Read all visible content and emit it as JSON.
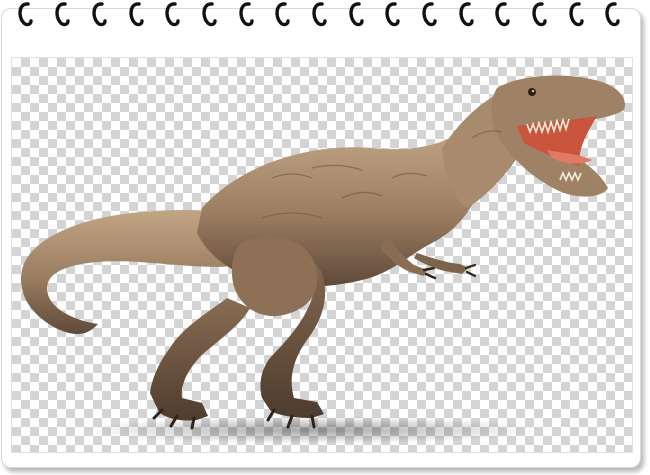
{
  "image": {
    "subject": "tyrannosaurus-rex",
    "background": "transparency-checkerboard",
    "colors": {
      "skin_light": "#b89a78",
      "skin_mid": "#8f7257",
      "skin_dark": "#5a4636",
      "mouth": "#c9553d",
      "checker_dark": "#d4d4d4",
      "checker_light": "#ffffff",
      "ring": "#111111"
    }
  },
  "binding": {
    "ring_count": 17,
    "icon": "spiral-ring-icon"
  }
}
